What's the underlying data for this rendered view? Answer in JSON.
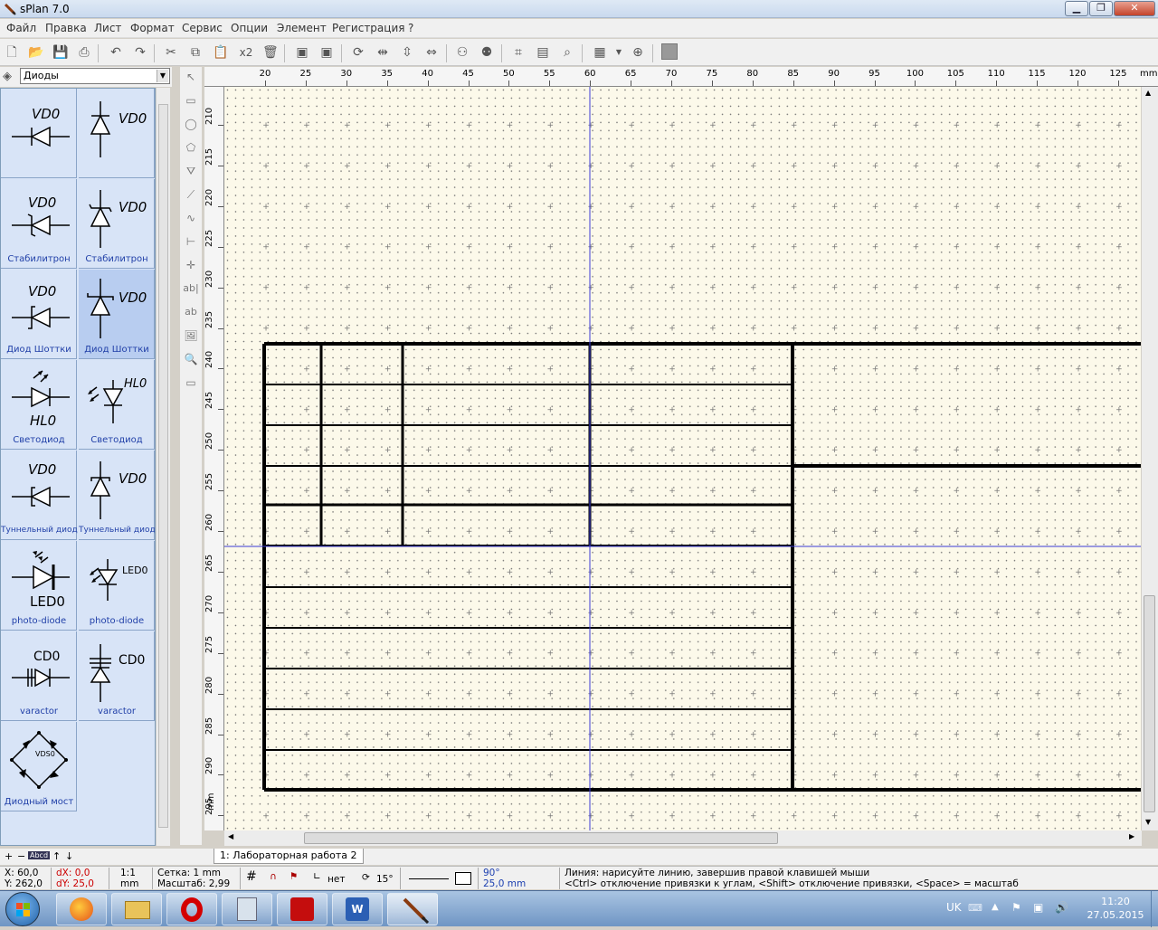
{
  "window": {
    "title": "sPlan 7.0"
  },
  "menu": [
    "Файл",
    "Правка",
    "Лист",
    "Формат",
    "Сервис",
    "Опции",
    "Элемент",
    "Регистрация",
    "?"
  ],
  "toolbar": {
    "scale_label": "x2"
  },
  "library": {
    "selected": "Диоды",
    "items": [
      {
        "label": "",
        "tag": "VD0"
      },
      {
        "label": "",
        "tag": "VD0"
      },
      {
        "label": "Стабилитрон",
        "tag": "VD0"
      },
      {
        "label": "Стабилитрон",
        "tag": "VD0"
      },
      {
        "label": "Диод Шоттки",
        "tag": "VD0"
      },
      {
        "label": "Диод Шоттки",
        "tag": "VD0"
      },
      {
        "label": "Светодиод",
        "tag": "HL0"
      },
      {
        "label": "Светодиод",
        "tag": "HL0"
      },
      {
        "label": "Туннельный диод",
        "tag": "VD0"
      },
      {
        "label": "Туннельный диод",
        "tag": "VD0"
      },
      {
        "label": "photo-diode",
        "tag": "LED0"
      },
      {
        "label": "photo-diode",
        "tag": "LED0"
      },
      {
        "label": "varactor",
        "tag": "CD0"
      },
      {
        "label": "varactor",
        "tag": "CD0"
      },
      {
        "label": "Диодный мост",
        "tag": "VDS0"
      }
    ],
    "footer": "Abcd"
  },
  "ruler": {
    "h_labels": [
      "20",
      "25",
      "30",
      "35",
      "40",
      "45",
      "50",
      "55",
      "60",
      "65",
      "70",
      "75",
      "80",
      "85",
      "90",
      "95",
      "100",
      "105",
      "110",
      "115",
      "120",
      "125"
    ],
    "h_unit": "mm",
    "v_labels": [
      "210",
      "215",
      "220",
      "225",
      "230",
      "235",
      "240",
      "245",
      "250",
      "255",
      "260",
      "265",
      "270",
      "275",
      "280",
      "285",
      "290",
      "295"
    ],
    "v_unit": "mm"
  },
  "tab": {
    "label": "1: Лабораторная работа 2"
  },
  "status": {
    "x": "X: 60,0",
    "y": "Y: 262,0",
    "dx": "dX: 0,0",
    "dy": "dY: 25,0",
    "ratio": "1:1",
    "unit": "mm",
    "grid": "Сетка: 1 mm",
    "zoom": "Масштаб:  2,99",
    "snap": "нет",
    "angle": "15°",
    "line_angle": "90°",
    "line_len": "25,0 mm",
    "hint1": "Линия: нарисуйте линию, завершив правой клавишей мыши",
    "hint2": "<Ctrl> отключение привязки к углам, <Shift> отключение привязки, <Space> = масштаб"
  },
  "taskbar": {
    "lang": "UK",
    "time": "11:20",
    "date": "27.05.2015"
  },
  "colors": {
    "canvas": "#fcf9ea",
    "lib_bg": "#d8e4f7",
    "lib_label": "#2140a8",
    "crosshair": "#3b3bd6"
  }
}
